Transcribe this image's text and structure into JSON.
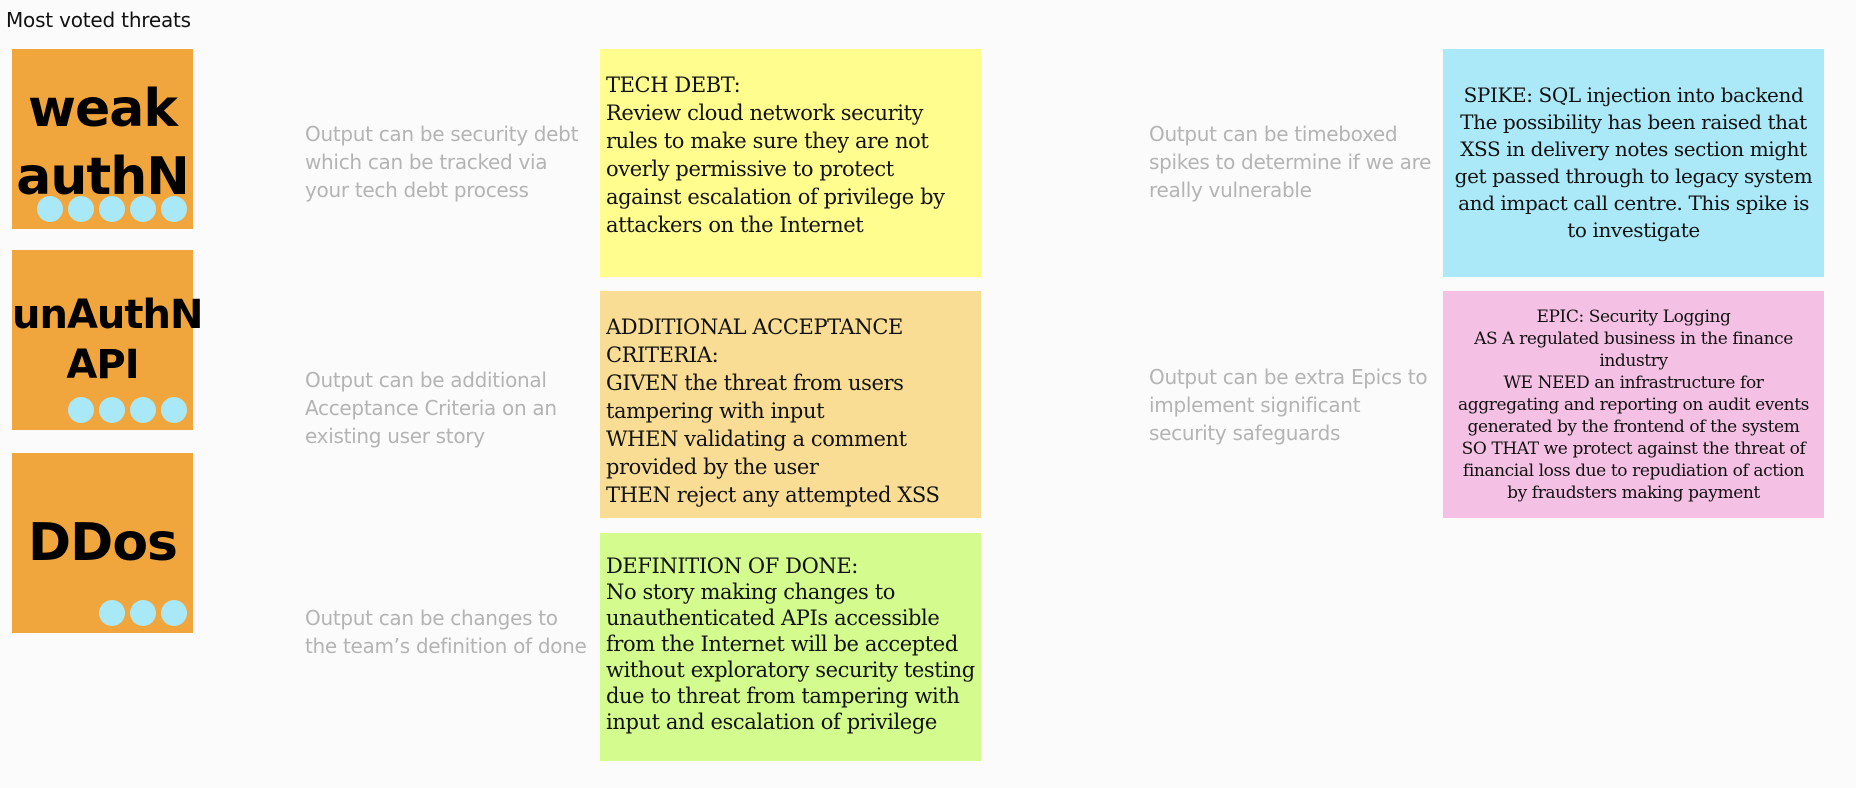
{
  "board": {
    "title": "Most voted threats"
  },
  "threats": [
    {
      "label": "weak\nauthN",
      "votes": 5
    },
    {
      "label": "unAuthN\nAPI",
      "votes": 4
    },
    {
      "label": "DDos",
      "votes": 3
    }
  ],
  "hints": [
    "Output can be security debt which can be tracked via your tech debt process",
    "Output can be additional Acceptance Criteria on an existing user story",
    "Output can be changes to the team’s definition of done",
    "Output can be timeboxed spikes to determine if we are really vulnerable",
    "Output can be extra Epics to implement significant security safeguards"
  ],
  "stickies": {
    "tech_debt": "TECH DEBT:\nReview cloud network security rules to make sure they are not overly permissive to protect against escalation of privilege by attackers on the Internet",
    "acceptance_criteria": "ADDITIONAL ACCEPTANCE CRITERIA:\nGIVEN the threat from users tampering with input\nWHEN validating a comment provided by the user\nTHEN reject any attempted XSS",
    "definition_of_done": "DEFINITION OF DONE:\nNo story making changes to unauthenticated APIs accessible from the Internet will be accepted without exploratory security testing due to threat from tampering with input and escalation of privilege",
    "spike": "SPIKE: SQL injection into backend\nThe possibility has been raised that XSS in delivery notes section might get passed through to legacy system and impact call centre. This spike is to investigate",
    "epic": "EPIC: Security Logging\nAS A regulated business in the finance industry\nWE NEED an infrastructure for aggregating and reporting on audit events generated by the frontend of the system\nSO THAT we protect against the threat of financial loss due to repudiation of action by fraudsters making payment"
  },
  "colors": {
    "threat_card": "#f0a63c",
    "vote_dot": "#a9e8f7",
    "tech_debt": "#fffd8e",
    "acceptance_criteria": "#f9dd94",
    "definition_of_done": "#d4fb8e",
    "spike": "#abe9f8",
    "epic": "#f4c0e4"
  }
}
